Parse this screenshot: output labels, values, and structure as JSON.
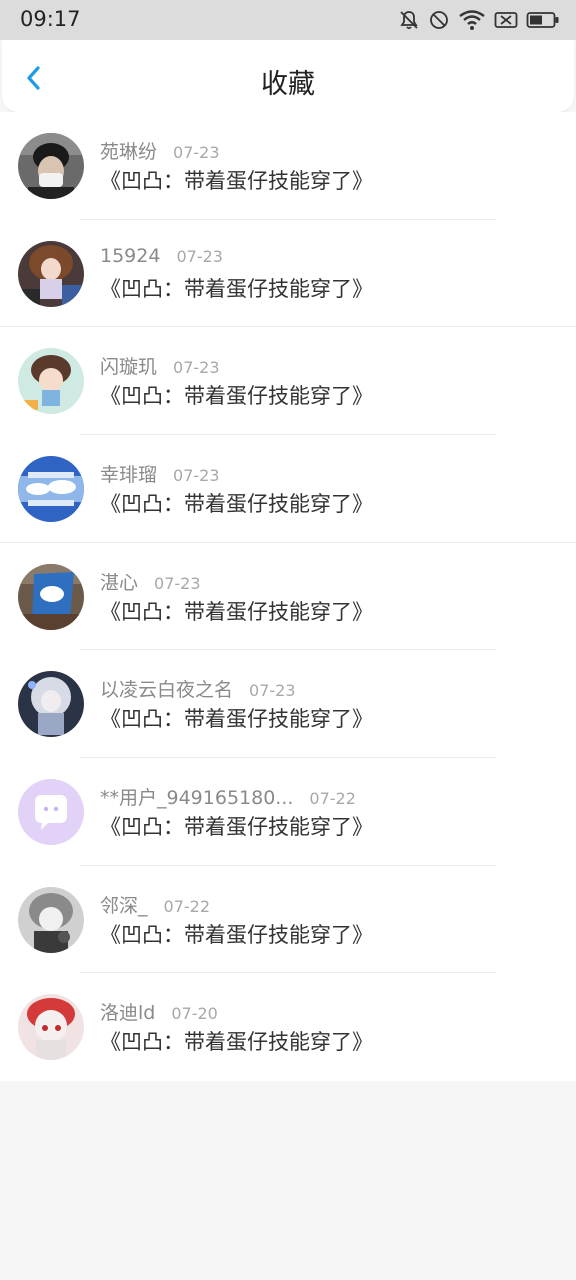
{
  "status_bar": {
    "time": "09:17",
    "icons": [
      "bell-off-icon",
      "do-not-disturb-icon",
      "wifi-icon",
      "sim-off-icon",
      "battery-icon"
    ]
  },
  "header": {
    "back_icon": "chevron-left-icon",
    "title": "收藏"
  },
  "items": [
    {
      "name": "苑琳纷",
      "date": "07-23",
      "title": "《凹凸：带着蛋仔技能穿了》"
    },
    {
      "name": "15924",
      "date": "07-23",
      "title": "《凹凸：带着蛋仔技能穿了》"
    },
    {
      "name": "闪璇玑",
      "date": "07-23",
      "title": "《凹凸：带着蛋仔技能穿了》"
    },
    {
      "name": "幸琲瑠",
      "date": "07-23",
      "title": "《凹凸：带着蛋仔技能穿了》"
    },
    {
      "name": "湛心",
      "date": "07-23",
      "title": "《凹凸：带着蛋仔技能穿了》"
    },
    {
      "name": "以凌云白夜之名",
      "date": "07-23",
      "title": "《凹凸：带着蛋仔技能穿了》"
    },
    {
      "name": "**用户_949165180...",
      "date": "07-22",
      "title": "《凹凸：带着蛋仔技能穿了》"
    },
    {
      "name": "邻深_",
      "date": "07-22",
      "title": "《凹凸：带着蛋仔技能穿了》"
    },
    {
      "name": "洛迪ld",
      "date": "07-20",
      "title": "《凹凸：带着蛋仔技能穿了》"
    }
  ],
  "colors": {
    "accent": "#1e9be6",
    "status_bar_bg": "#dcdcdc",
    "page_bg": "#f6f6f6"
  }
}
